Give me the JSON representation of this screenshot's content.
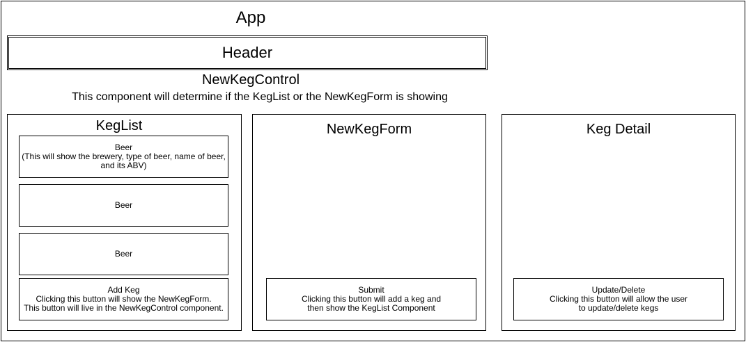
{
  "app": {
    "title": "App"
  },
  "header": {
    "title": "Header"
  },
  "new_keg_control": {
    "title": "NewKegControl",
    "description": "This component will determine if the KegList or the NewKegForm is showing"
  },
  "keg_list": {
    "title": "KegList",
    "beers": [
      {
        "title": "Beer",
        "lines": [
          "(This will show the brewery, type of beer, name of beer,",
          "and its ABV)"
        ]
      },
      {
        "title": "Beer",
        "lines": []
      },
      {
        "title": "Beer",
        "lines": []
      }
    ],
    "add_keg": {
      "title": "Add Keg",
      "lines": [
        "Clicking this button will show the NewKegForm.",
        "This button will live in the NewKegControl component."
      ]
    }
  },
  "new_keg_form": {
    "title": "NewKegForm",
    "submit": {
      "title": "Submit",
      "lines": [
        "Clicking this button will add a keg and",
        "then show the KegList Component"
      ]
    }
  },
  "keg_detail": {
    "title": "Keg Detail",
    "update_delete": {
      "title": "Update/Delete",
      "lines": [
        "Clicking this button will allow the user",
        "to update/delete kegs"
      ]
    }
  }
}
